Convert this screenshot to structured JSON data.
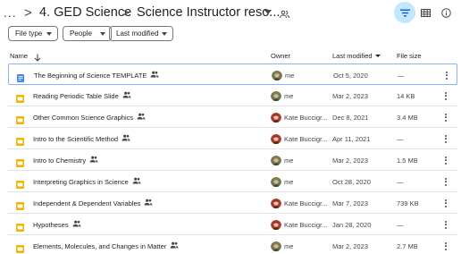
{
  "breadcrumb": {
    "ellipsis": "...",
    "separator": ">",
    "items": [
      "4. GED Science",
      "Science Instructor reso..."
    ]
  },
  "header_icons": {
    "shared": "shared-folder-icon",
    "filter": "filter-icon",
    "view": "grid-view-icon",
    "info": "info-icon"
  },
  "filters": {
    "file_type": "File type",
    "people": "People",
    "last_modified": "Last modified"
  },
  "columns": {
    "name": "Name",
    "owner": "Owner",
    "last_modified": "Last modified",
    "file_size": "File size"
  },
  "colors": {
    "doc_blue": "#4285f4",
    "slides_yellow": "#f4b400",
    "filter_active_bg": "#c2e7ff",
    "selected_border": "#8ab4f8"
  },
  "files": [
    {
      "name": "The Beginning of Science TEMPLATE",
      "type": "doc",
      "owner": "me",
      "avatar": "me",
      "modified": "Oct 5, 2020",
      "size": "—"
    },
    {
      "name": "Reading Periodic Table Slide",
      "type": "slides",
      "owner": "me",
      "avatar": "me",
      "modified": "Mar 2, 2023",
      "size": "14 KB"
    },
    {
      "name": "Other Common Science Graphics",
      "type": "slides",
      "owner": "Kate Buccigr...",
      "avatar": "kate",
      "modified": "Dec 8, 2021",
      "size": "3.4 MB"
    },
    {
      "name": "Intro to the Scientific Method",
      "type": "slides",
      "owner": "Kate Buccigr...",
      "avatar": "kate",
      "modified": "Apr 11, 2021",
      "size": "—"
    },
    {
      "name": "Intro to Chemistry",
      "type": "slides",
      "owner": "me",
      "avatar": "me",
      "modified": "Mar 2, 2023",
      "size": "1.5 MB"
    },
    {
      "name": "Interpreting Graphics in Science",
      "type": "slides",
      "owner": "me",
      "avatar": "me",
      "modified": "Oct 28, 2020",
      "size": "—"
    },
    {
      "name": "Independent & Dependent Variables",
      "type": "slides",
      "owner": "Kate Buccigr...",
      "avatar": "kate",
      "modified": "Mar 7, 2023",
      "size": "739 KB"
    },
    {
      "name": "Hypotheses",
      "type": "slides",
      "owner": "Kate Buccigr...",
      "avatar": "kate",
      "modified": "Jan 28, 2020",
      "size": "—"
    },
    {
      "name": "Elements, Molecules, and Changes in Matter",
      "type": "slides",
      "owner": "me",
      "avatar": "me",
      "modified": "Mar 2, 2023",
      "size": "2.7 MB"
    }
  ]
}
